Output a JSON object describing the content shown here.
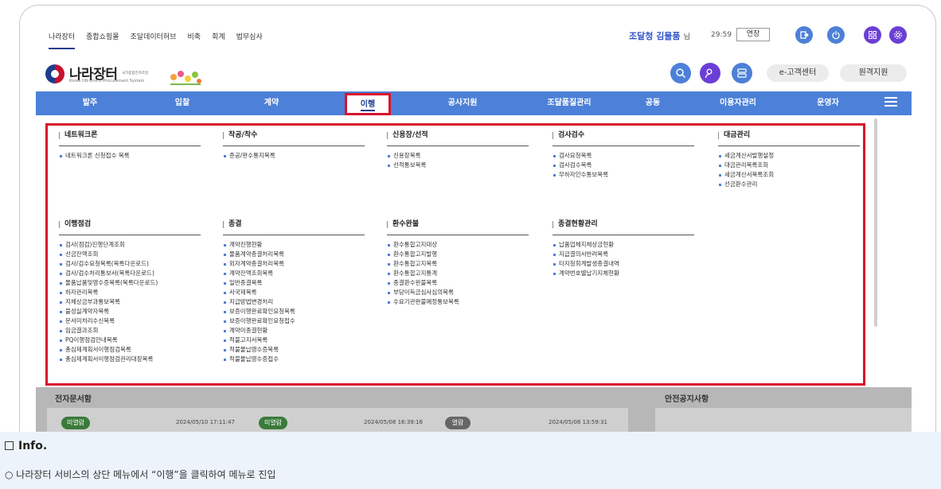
{
  "util_bar": {
    "links": [
      "나라장터",
      "종합쇼핑몰",
      "조달데이터허브",
      "비축",
      "회계",
      "법무심사"
    ],
    "user_name": "조달청 김물품",
    "user_suffix": "님",
    "timer": "29:59",
    "extend_label": "연장"
  },
  "logo": {
    "name": "나라장터",
    "small_text": "국가종합전자조달",
    "english": "Korea ON-Line E-Procurement System"
  },
  "header_buttons": {
    "customer_center": "e-고객센터",
    "remote_support": "원격지원"
  },
  "nav": {
    "items": [
      "발주",
      "입찰",
      "계약",
      "이행",
      "공사지원",
      "조달품질관리",
      "공동",
      "이용자관리",
      "운영자"
    ],
    "active": "이행"
  },
  "dropdown": {
    "columns": [
      {
        "title": "네트워크론",
        "items": [
          "네트워크론 신청접수 목록"
        ]
      },
      {
        "title": "착공/착수",
        "items": [
          "준공/완수통지목록"
        ]
      },
      {
        "title": "신용장/선적",
        "items": [
          "신용장목록",
          "선적통보목록"
        ]
      },
      {
        "title": "검사검수",
        "items": [
          "검사요청목록",
          "검사검수목록",
          "무하자인수통보목록"
        ]
      },
      {
        "title": "대금관리",
        "items": [
          "세금계산서발행설정",
          "대금관리목록조회",
          "세금계산서목록조회",
          "선금환수관리"
        ]
      },
      {
        "title": "이행점검",
        "items": [
          "검사(점검)진행단계조회",
          "선금잔액조회",
          "검사/검수요청목록(목록다운로드)",
          "검사/검수처리통보서(목록다운로드)",
          "물품납품및영수증목록(목록다운로드)",
          "하자관리목록",
          "지체상금부과통보목록",
          "불성실계약자목록",
          "문서미처리수신목록",
          "임금결과조회",
          "PQ이행점검안내목록",
          "총심제계획서이행점검목록",
          "총심제계획서이행점검관리대장목록"
        ]
      },
      {
        "title": "종결",
        "items": [
          "계약진행현황",
          "물품계약종결처리목록",
          "외자계약종결처리목록",
          "계약잔액조회목록",
          "일반종결목록",
          "사국제목록",
          "지급방법변경처리",
          "보증이행완료확인요청목록",
          "보증이행완료확인요청접수",
          "계약미종결현황",
          "적불고지서목록",
          "적불물납영수증목록",
          "적불물납영수증접수"
        ]
      },
      {
        "title": "환수완불",
        "items": [
          "환수통합고지대상",
          "환수통합고지발행",
          "환수통합고지목록",
          "환수통합고지통계",
          "종결환수완불목록",
          "부당이득금심사심의목록",
          "수요기관완불예정통보목록"
        ]
      },
      {
        "title": "종결현황관리",
        "items": [
          "납품업체지체상금현황",
          "지급결의서반려목록",
          "타지청회계발생종결내역",
          "계약번호별납기지체현황"
        ]
      }
    ]
  },
  "background": {
    "section_title": "전자문서함",
    "section_title_right": "안전공지사항",
    "cards": [
      {
        "badge": "미열람",
        "date": "2024/05/10 17:11:47",
        "color": "#3a7a3a"
      },
      {
        "badge": "미열람",
        "date": "2024/05/08 16:39:16",
        "color": "#3a7a3a"
      },
      {
        "badge": "열람",
        "date": "2024/05/08 13:59:31",
        "color": "#666666"
      }
    ]
  },
  "info": {
    "heading": "Info.",
    "text": "○ 나라장터 서비스의 상단 메뉴에서 “이행”을 클릭하여 메뉴로 진입"
  }
}
